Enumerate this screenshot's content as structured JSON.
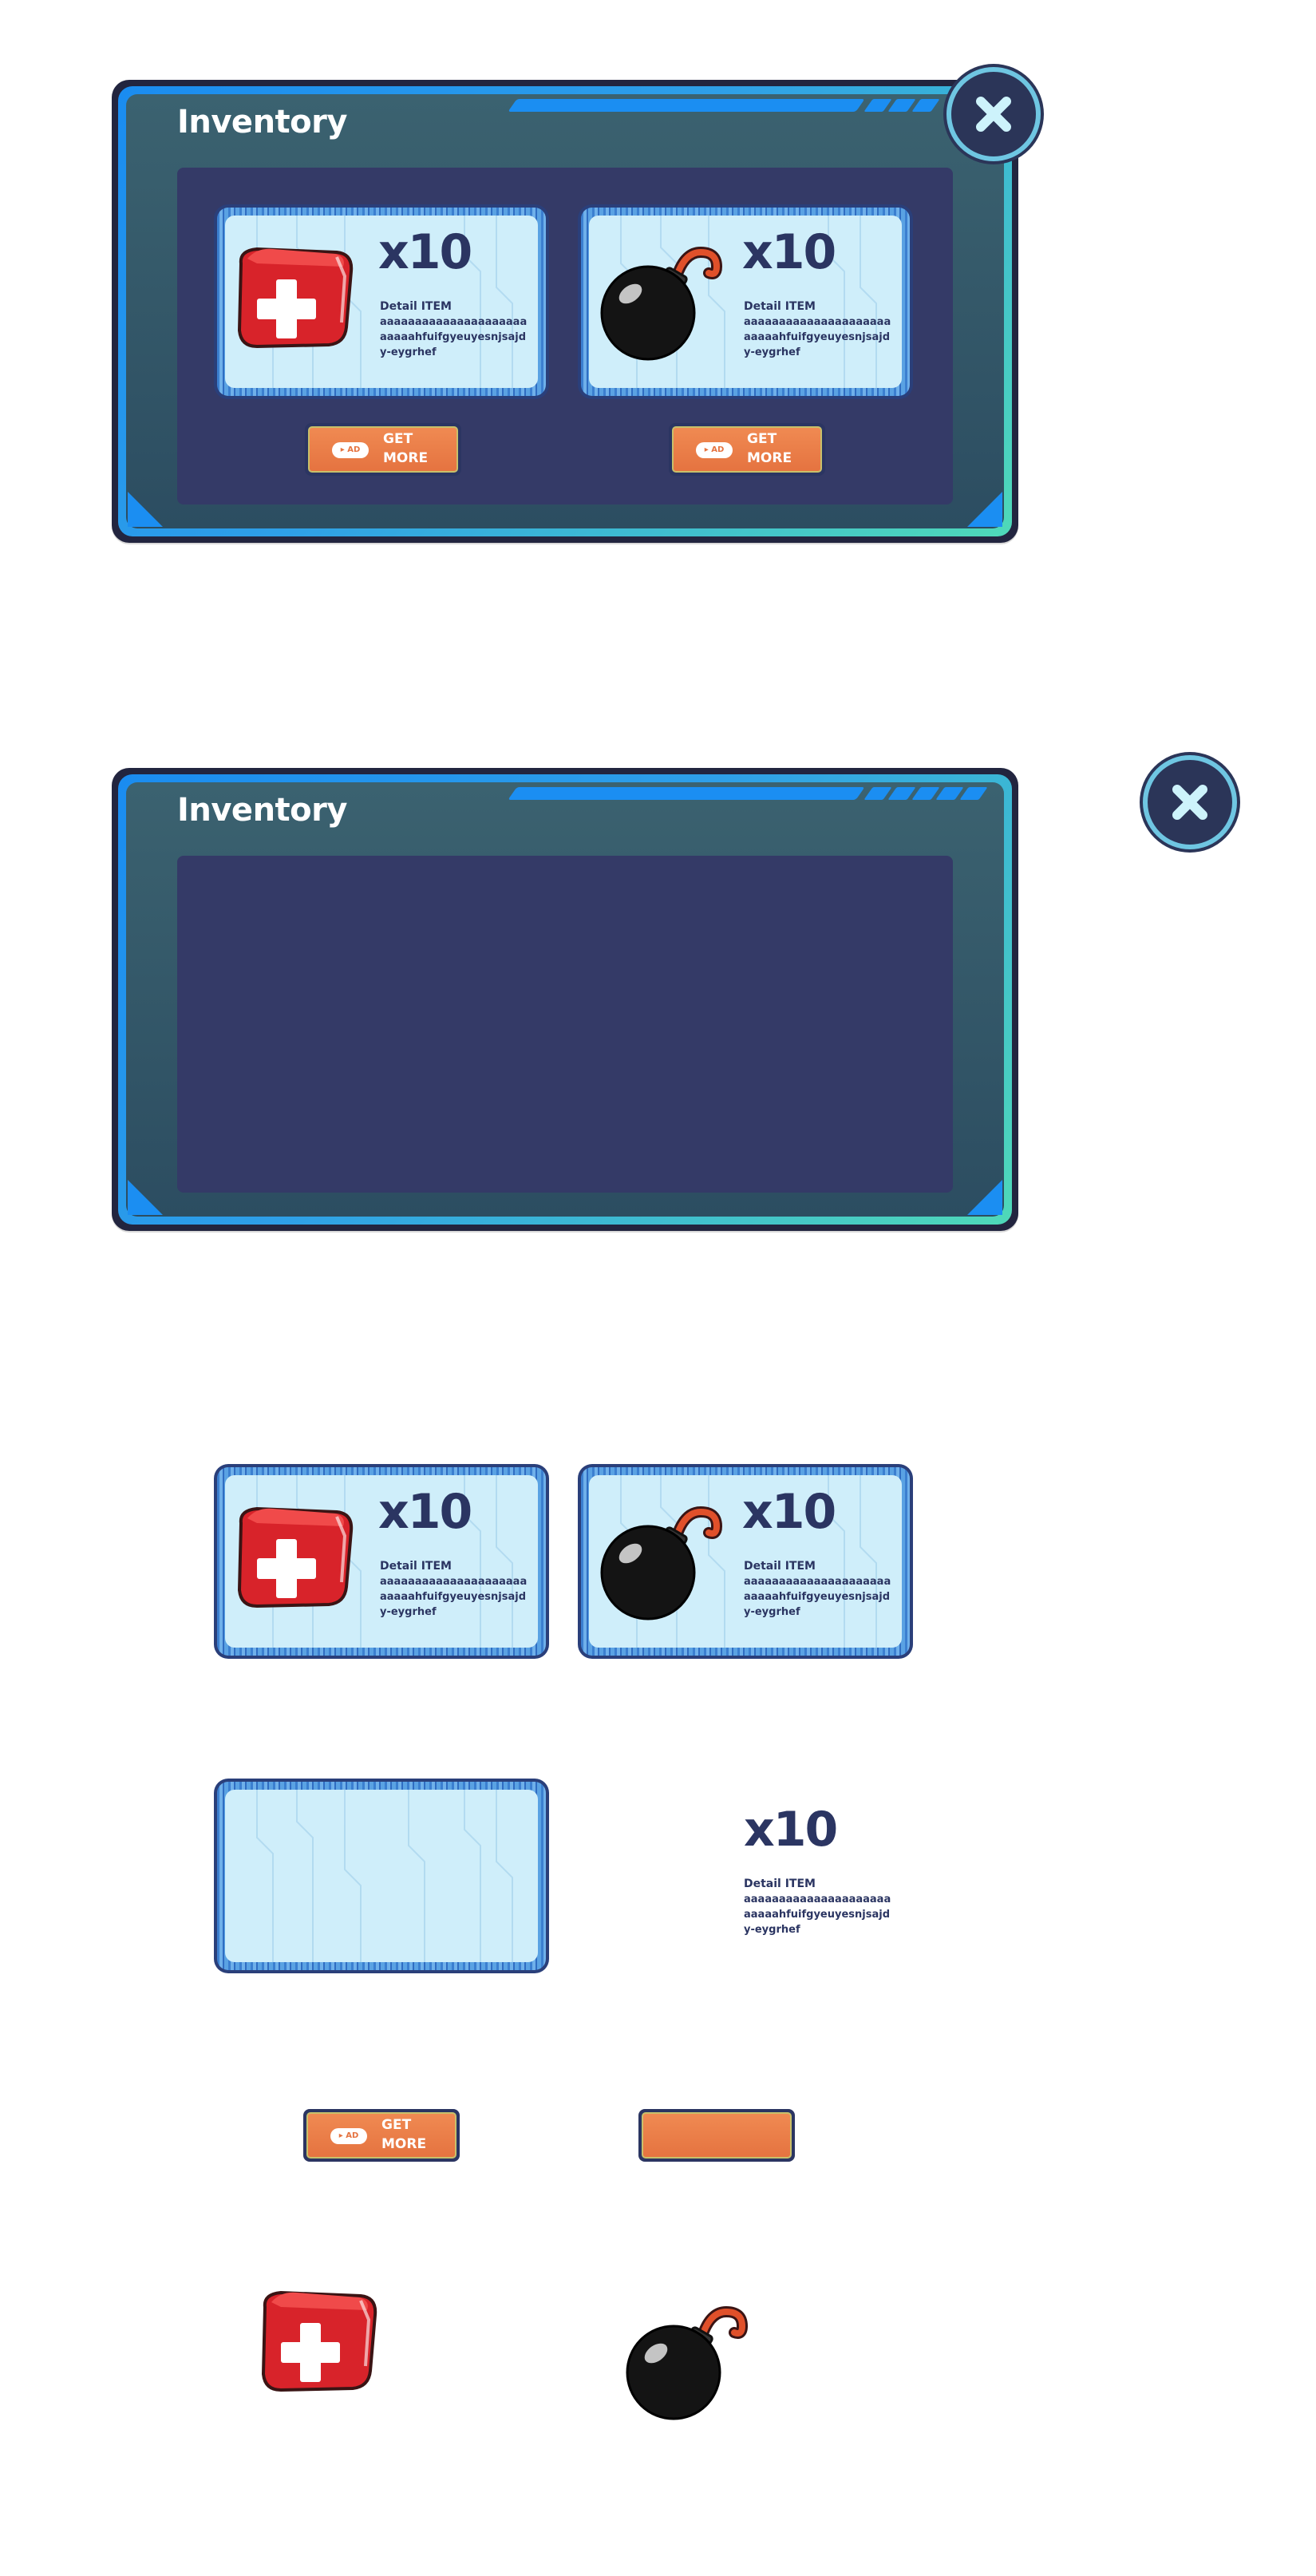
{
  "panel_title": "Inventory",
  "colors": {
    "panel_rim_start": "#1a8cf0",
    "panel_rim_end": "#4fd9b8",
    "panel_content": "#343a67",
    "card_face": "#cfeefa",
    "text_dark": "#2b3562",
    "button_orange": "#e57340"
  },
  "close_button": {
    "icon": "close-icon"
  },
  "items": [
    {
      "icon": "first-aid-kit-icon",
      "quantity": "x10",
      "detail_title": "Detail ITEM",
      "detail_desc": "aaaaaaaaaaaaaaaaaaaaaaaaaahfuifgyeuyesnjsajdy-eygrhef"
    },
    {
      "icon": "bomb-icon",
      "quantity": "x10",
      "detail_title": "Detail ITEM",
      "detail_desc": "aaaaaaaaaaaaaaaaaaaaaaaaaahfuifgyeuyesnjsajdy-eygrhef"
    }
  ],
  "get_more_button": {
    "ad_label": "▸ AD",
    "label": "GET MORE"
  }
}
